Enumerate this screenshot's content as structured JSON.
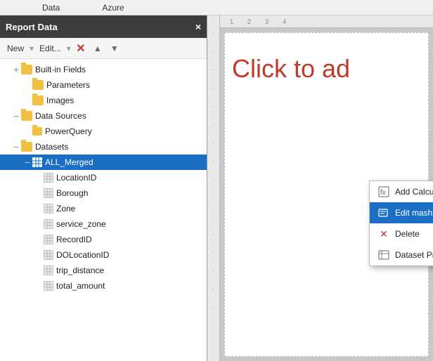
{
  "topbar": {
    "items": [
      "Data",
      "Azure"
    ]
  },
  "panel": {
    "title": "Report Data",
    "close_label": "×",
    "toolbar": {
      "new_label": "New",
      "edit_label": "Edit...",
      "delete_icon": "×",
      "up_icon": "▲",
      "down_icon": "▼"
    }
  },
  "tree": {
    "items": [
      {
        "id": "builtin-fields",
        "label": "Built-in Fields",
        "level": 1,
        "type": "folder",
        "expanded": true,
        "has_expand": true
      },
      {
        "id": "parameters",
        "label": "Parameters",
        "level": 2,
        "type": "folder",
        "expanded": false,
        "has_expand": false
      },
      {
        "id": "images",
        "label": "Images",
        "level": 2,
        "type": "folder",
        "expanded": false,
        "has_expand": false
      },
      {
        "id": "data-sources",
        "label": "Data Sources",
        "level": 1,
        "type": "folder",
        "expanded": true,
        "has_expand": true
      },
      {
        "id": "powerquery",
        "label": "PowerQuery",
        "level": 2,
        "type": "folder-small",
        "expanded": false,
        "has_expand": false
      },
      {
        "id": "datasets",
        "label": "Datasets",
        "level": 1,
        "type": "folder",
        "expanded": true,
        "has_expand": true
      },
      {
        "id": "all-merged",
        "label": "ALL_Merged",
        "level": 2,
        "type": "dataset",
        "expanded": true,
        "has_expand": true,
        "selected": true
      },
      {
        "id": "locationid",
        "label": "LocationID",
        "level": 3,
        "type": "field",
        "has_expand": false
      },
      {
        "id": "borough",
        "label": "Borough",
        "level": 3,
        "type": "field",
        "has_expand": false
      },
      {
        "id": "zone",
        "label": "Zone",
        "level": 3,
        "type": "field",
        "has_expand": false
      },
      {
        "id": "service-zone",
        "label": "service_zone",
        "level": 3,
        "type": "field",
        "has_expand": false
      },
      {
        "id": "recordid",
        "label": "RecordID",
        "level": 3,
        "type": "field",
        "has_expand": false
      },
      {
        "id": "dolocationid",
        "label": "DOLocationID",
        "level": 3,
        "type": "field",
        "has_expand": false
      },
      {
        "id": "trip-distance",
        "label": "trip_distance",
        "level": 3,
        "type": "field",
        "has_expand": false
      },
      {
        "id": "total-amount",
        "label": "total_amount",
        "level": 3,
        "type": "field",
        "has_expand": false
      }
    ]
  },
  "context_menu": {
    "items": [
      {
        "id": "add-calculated",
        "label": "Add Calculated Field...",
        "icon": "dots"
      },
      {
        "id": "edit-mashup",
        "label": "Edit mashup...",
        "icon": "edit",
        "active": true
      },
      {
        "id": "delete",
        "label": "Delete",
        "icon": "delete"
      },
      {
        "id": "dataset-properties",
        "label": "Dataset Properties",
        "icon": "properties"
      }
    ]
  },
  "canvas": {
    "click_to_add": "Click to ad"
  },
  "ruler": {
    "ticks": [
      "1",
      "2",
      "3",
      "4"
    ]
  }
}
